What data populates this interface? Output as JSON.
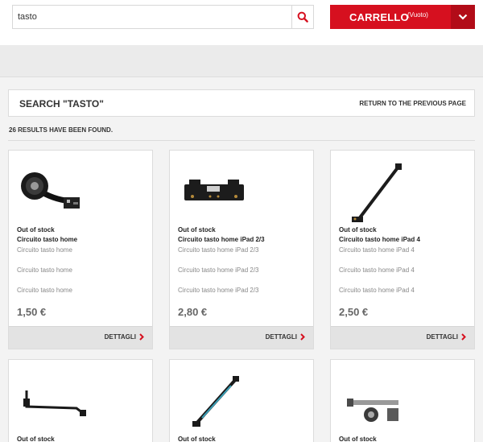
{
  "search": {
    "value": "tasto",
    "placeholder": ""
  },
  "cart": {
    "label": "CARRELLO",
    "status": "(Vuoto)"
  },
  "page": {
    "title": "SEARCH \"TASTO\"",
    "return_link": "RETURN TO THE PREVIOUS PAGE",
    "results_count": "26 RESULTS HAVE BEEN FOUND."
  },
  "colors": {
    "accent": "#d6101f",
    "accent_dark": "#b20c18",
    "background": "#f3f3f3"
  },
  "products": [
    {
      "status": "Out of stock",
      "name": "Circuito tasto home",
      "desc": [
        "Circuito tasto home",
        "Circuito tasto home",
        "Circuito tasto home"
      ],
      "price": "1,50 €",
      "cta": "DETTAGLI"
    },
    {
      "status": "Out of stock",
      "name": "Circuito tasto home iPad 2/3",
      "desc": [
        "Circuito tasto home iPad 2/3",
        "Circuito tasto home iPad 2/3",
        "Circuito tasto home iPad 2/3"
      ],
      "price": "2,80 €",
      "cta": "DETTAGLI"
    },
    {
      "status": "Out of stock",
      "name": "Circuito tasto home iPad 4",
      "desc": [
        "Circuito tasto home iPad 4",
        "Circuito tasto home iPad 4",
        "Circuito tasto home iPad 4"
      ],
      "price": "2,50 €",
      "cta": "DETTAGLI"
    },
    {
      "status": "Out of stock"
    },
    {
      "status": "Out of stock"
    },
    {
      "status": "Out of stock"
    }
  ]
}
